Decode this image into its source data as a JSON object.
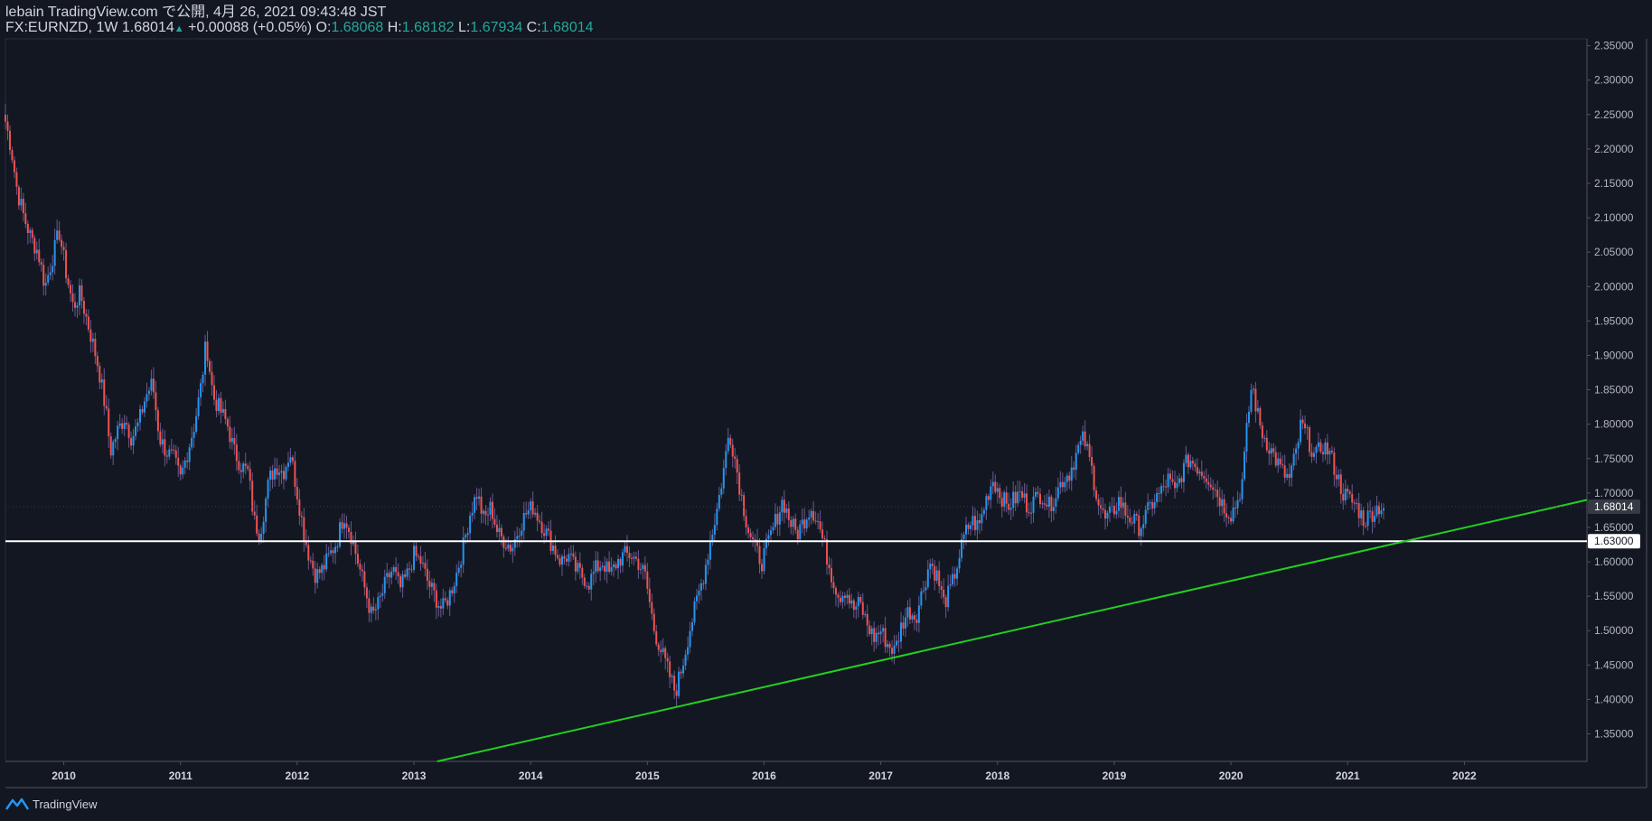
{
  "header": {
    "publish_line": "lebain TradingView.com で公開, 4月 26, 2021 09:43:48 JST",
    "symbol": "FX:EURNZD, 1W",
    "last": "1.68014",
    "change": "+0.00088 (+0.05%)",
    "o_label": "O:",
    "o_value": "1.68068",
    "h_label": "H:",
    "h_value": "1.68182",
    "l_label": "L:",
    "l_value": "1.67934",
    "c_label": "C:",
    "c_value": "1.68014"
  },
  "footer": {
    "brand": "TradingView"
  },
  "colors": {
    "background": "#131722",
    "up": "#2196f3",
    "down": "#ef5350",
    "wick": "#6a5a8c",
    "support_line": "#ffffff",
    "trend_line": "#22d01e",
    "text": "#b2b5be",
    "teal": "#26a69a"
  },
  "chart_data": {
    "type": "candlestick",
    "symbol": "FX:EURNZD",
    "interval": "1W",
    "x_tick_labels": [
      "2010",
      "2011",
      "2012",
      "2013",
      "2014",
      "2015",
      "2016",
      "2017",
      "2018",
      "2019",
      "2020",
      "2021",
      "2022"
    ],
    "y_tick_labels": [
      "2.35000",
      "2.30000",
      "2.25000",
      "2.20000",
      "2.15000",
      "2.10000",
      "2.05000",
      "2.00000",
      "1.95000",
      "1.90000",
      "1.85000",
      "1.80000",
      "1.75000",
      "1.70000",
      "1.65000",
      "1.60000",
      "1.55000",
      "1.50000",
      "1.45000",
      "1.40000",
      "1.35000"
    ],
    "ylim": [
      1.31,
      2.36
    ],
    "xlim": [
      2009.5,
      2023.05
    ],
    "close_path": [
      [
        2009.5,
        2.24
      ],
      [
        2009.55,
        2.2
      ],
      [
        2009.6,
        2.14
      ],
      [
        2009.66,
        2.1
      ],
      [
        2009.72,
        2.07
      ],
      [
        2009.78,
        2.05
      ],
      [
        2009.84,
        2.0
      ],
      [
        2009.9,
        2.04
      ],
      [
        2009.96,
        2.08
      ],
      [
        2010.02,
        2.02
      ],
      [
        2010.08,
        1.97
      ],
      [
        2010.14,
        1.99
      ],
      [
        2010.2,
        1.95
      ],
      [
        2010.26,
        1.91
      ],
      [
        2010.3,
        1.88
      ],
      [
        2010.36,
        1.82
      ],
      [
        2010.4,
        1.76
      ],
      [
        2010.46,
        1.79
      ],
      [
        2010.52,
        1.81
      ],
      [
        2010.58,
        1.78
      ],
      [
        2010.64,
        1.8
      ],
      [
        2010.7,
        1.84
      ],
      [
        2010.76,
        1.86
      ],
      [
        2010.82,
        1.78
      ],
      [
        2010.88,
        1.76
      ],
      [
        2010.94,
        1.75
      ],
      [
        2011.0,
        1.72
      ],
      [
        2011.06,
        1.76
      ],
      [
        2011.12,
        1.8
      ],
      [
        2011.18,
        1.86
      ],
      [
        2011.22,
        1.92
      ],
      [
        2011.28,
        1.84
      ],
      [
        2011.34,
        1.82
      ],
      [
        2011.4,
        1.8
      ],
      [
        2011.46,
        1.76
      ],
      [
        2011.52,
        1.74
      ],
      [
        2011.58,
        1.73
      ],
      [
        2011.63,
        1.66
      ],
      [
        2011.68,
        1.64
      ],
      [
        2011.72,
        1.68
      ],
      [
        2011.76,
        1.72
      ],
      [
        2011.82,
        1.74
      ],
      [
        2011.88,
        1.73
      ],
      [
        2011.94,
        1.76
      ],
      [
        2012.0,
        1.7
      ],
      [
        2012.06,
        1.64
      ],
      [
        2012.1,
        1.61
      ],
      [
        2012.16,
        1.58
      ],
      [
        2012.22,
        1.59
      ],
      [
        2012.28,
        1.61
      ],
      [
        2012.34,
        1.63
      ],
      [
        2012.4,
        1.67
      ],
      [
        2012.46,
        1.64
      ],
      [
        2012.52,
        1.6
      ],
      [
        2012.58,
        1.56
      ],
      [
        2012.64,
        1.52
      ],
      [
        2012.7,
        1.54
      ],
      [
        2012.76,
        1.57
      ],
      [
        2012.82,
        1.59
      ],
      [
        2012.88,
        1.56
      ],
      [
        2012.94,
        1.58
      ],
      [
        2013.0,
        1.61
      ],
      [
        2013.06,
        1.6
      ],
      [
        2013.12,
        1.57
      ],
      [
        2013.18,
        1.55
      ],
      [
        2013.24,
        1.53
      ],
      [
        2013.3,
        1.55
      ],
      [
        2013.36,
        1.58
      ],
      [
        2013.42,
        1.62
      ],
      [
        2013.48,
        1.67
      ],
      [
        2013.54,
        1.7
      ],
      [
        2013.6,
        1.66
      ],
      [
        2013.66,
        1.68
      ],
      [
        2013.72,
        1.64
      ],
      [
        2013.78,
        1.63
      ],
      [
        2013.84,
        1.62
      ],
      [
        2013.9,
        1.65
      ],
      [
        2013.96,
        1.67
      ],
      [
        2014.02,
        1.68
      ],
      [
        2014.08,
        1.66
      ],
      [
        2014.14,
        1.64
      ],
      [
        2014.2,
        1.62
      ],
      [
        2014.26,
        1.6
      ],
      [
        2014.32,
        1.61
      ],
      [
        2014.38,
        1.59
      ],
      [
        2014.44,
        1.58
      ],
      [
        2014.5,
        1.57
      ],
      [
        2014.56,
        1.59
      ],
      [
        2014.62,
        1.6
      ],
      [
        2014.68,
        1.58
      ],
      [
        2014.74,
        1.6
      ],
      [
        2014.8,
        1.61
      ],
      [
        2014.86,
        1.61
      ],
      [
        2014.92,
        1.6
      ],
      [
        2014.98,
        1.58
      ],
      [
        2015.02,
        1.54
      ],
      [
        2015.06,
        1.5
      ],
      [
        2015.12,
        1.47
      ],
      [
        2015.18,
        1.44
      ],
      [
        2015.24,
        1.41
      ],
      [
        2015.3,
        1.45
      ],
      [
        2015.36,
        1.5
      ],
      [
        2015.42,
        1.54
      ],
      [
        2015.48,
        1.58
      ],
      [
        2015.54,
        1.63
      ],
      [
        2015.6,
        1.68
      ],
      [
        2015.66,
        1.74
      ],
      [
        2015.7,
        1.79
      ],
      [
        2015.74,
        1.76
      ],
      [
        2015.8,
        1.7
      ],
      [
        2015.86,
        1.65
      ],
      [
        2015.92,
        1.62
      ],
      [
        2015.98,
        1.6
      ],
      [
        2016.04,
        1.63
      ],
      [
        2016.1,
        1.66
      ],
      [
        2016.16,
        1.69
      ],
      [
        2016.22,
        1.66
      ],
      [
        2016.28,
        1.64
      ],
      [
        2016.34,
        1.66
      ],
      [
        2016.4,
        1.68
      ],
      [
        2016.46,
        1.66
      ],
      [
        2016.52,
        1.62
      ],
      [
        2016.58,
        1.58
      ],
      [
        2016.64,
        1.55
      ],
      [
        2016.7,
        1.56
      ],
      [
        2016.76,
        1.53
      ],
      [
        2016.82,
        1.54
      ],
      [
        2016.88,
        1.51
      ],
      [
        2016.94,
        1.49
      ],
      [
        2017.0,
        1.5
      ],
      [
        2017.06,
        1.48
      ],
      [
        2017.12,
        1.47
      ],
      [
        2017.18,
        1.51
      ],
      [
        2017.24,
        1.53
      ],
      [
        2017.3,
        1.52
      ],
      [
        2017.36,
        1.56
      ],
      [
        2017.42,
        1.6
      ],
      [
        2017.48,
        1.58
      ],
      [
        2017.54,
        1.54
      ],
      [
        2017.6,
        1.56
      ],
      [
        2017.66,
        1.6
      ],
      [
        2017.72,
        1.64
      ],
      [
        2017.78,
        1.66
      ],
      [
        2017.84,
        1.65
      ],
      [
        2017.9,
        1.69
      ],
      [
        2017.96,
        1.72
      ],
      [
        2018.02,
        1.7
      ],
      [
        2018.08,
        1.68
      ],
      [
        2018.14,
        1.69
      ],
      [
        2018.2,
        1.7
      ],
      [
        2018.26,
        1.68
      ],
      [
        2018.32,
        1.69
      ],
      [
        2018.38,
        1.7
      ],
      [
        2018.44,
        1.68
      ],
      [
        2018.5,
        1.7
      ],
      [
        2018.56,
        1.72
      ],
      [
        2018.62,
        1.73
      ],
      [
        2018.68,
        1.76
      ],
      [
        2018.74,
        1.78
      ],
      [
        2018.8,
        1.74
      ],
      [
        2018.86,
        1.69
      ],
      [
        2018.92,
        1.66
      ],
      [
        2018.98,
        1.67
      ],
      [
        2019.04,
        1.69
      ],
      [
        2019.1,
        1.67
      ],
      [
        2019.16,
        1.66
      ],
      [
        2019.22,
        1.65
      ],
      [
        2019.28,
        1.67
      ],
      [
        2019.34,
        1.69
      ],
      [
        2019.4,
        1.7
      ],
      [
        2019.46,
        1.72
      ],
      [
        2019.52,
        1.7
      ],
      [
        2019.58,
        1.73
      ],
      [
        2019.64,
        1.75
      ],
      [
        2019.7,
        1.74
      ],
      [
        2019.76,
        1.73
      ],
      [
        2019.82,
        1.72
      ],
      [
        2019.88,
        1.7
      ],
      [
        2019.94,
        1.68
      ],
      [
        2020.0,
        1.67
      ],
      [
        2020.06,
        1.69
      ],
      [
        2020.1,
        1.72
      ],
      [
        2020.14,
        1.8
      ],
      [
        2020.18,
        1.86
      ],
      [
        2020.22,
        1.82
      ],
      [
        2020.26,
        1.79
      ],
      [
        2020.32,
        1.77
      ],
      [
        2020.38,
        1.75
      ],
      [
        2020.44,
        1.73
      ],
      [
        2020.5,
        1.72
      ],
      [
        2020.56,
        1.76
      ],
      [
        2020.6,
        1.8
      ],
      [
        2020.66,
        1.78
      ],
      [
        2020.72,
        1.75
      ],
      [
        2020.78,
        1.77
      ],
      [
        2020.84,
        1.76
      ],
      [
        2020.9,
        1.73
      ],
      [
        2020.96,
        1.7
      ],
      [
        2021.02,
        1.69
      ],
      [
        2021.08,
        1.68
      ],
      [
        2021.14,
        1.66
      ],
      [
        2021.2,
        1.67
      ],
      [
        2021.26,
        1.68
      ],
      [
        2021.31,
        1.68
      ]
    ],
    "lines": [
      {
        "name": "",
        "kind": "horizontal",
        "y": 1.63
      },
      {
        "name": "",
        "kind": "trend",
        "points": [
          [
            2013.2,
            1.31
          ],
          [
            2023.05,
            1.69
          ]
        ]
      }
    ],
    "price_labels": [
      {
        "value": "1.68014",
        "y": 1.68014
      },
      {
        "value": "1.63000",
        "y": 1.63
      }
    ]
  }
}
